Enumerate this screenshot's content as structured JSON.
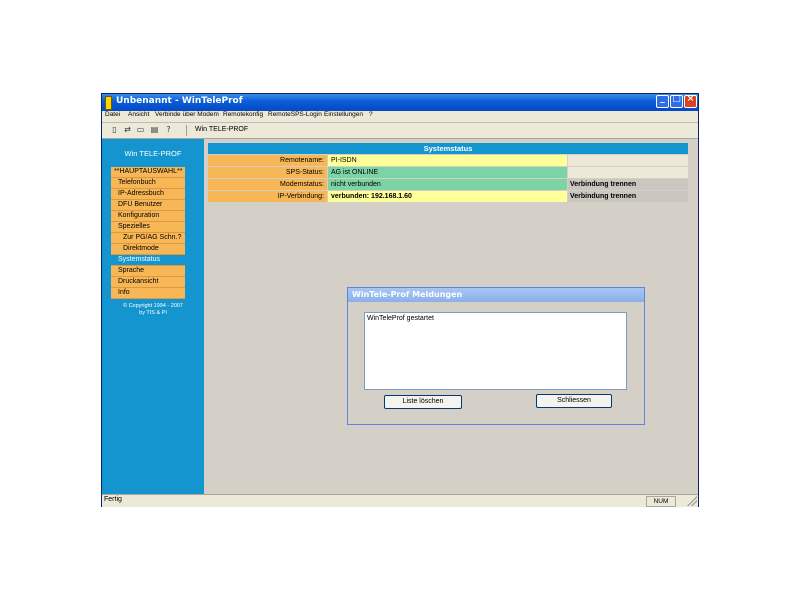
{
  "window": {
    "title": "Unbenannt - WinTeleProf"
  },
  "menu": [
    {
      "label": "Datei"
    },
    {
      "label": "Ansicht"
    },
    {
      "label": "Verbinde über Modem"
    },
    {
      "label": "Remotekonfig"
    },
    {
      "label": "RemoteSPS-Login"
    },
    {
      "label": "Einstellungen"
    },
    {
      "label": "?"
    }
  ],
  "toolbar": {
    "icons": [
      "new-icon",
      "connect-icon",
      "modem-icon",
      "print-icon",
      "help-icon"
    ],
    "title": "Win TELE-PROF"
  },
  "sidebar": {
    "title": "Win TELE-PROF",
    "items": [
      {
        "label": "**HAUPTAUSWAHL**"
      },
      {
        "label": "Telefonbuch"
      },
      {
        "label": "IP-Adressbuch"
      },
      {
        "label": "DFÜ Benutzer"
      },
      {
        "label": "Konfiguration"
      },
      {
        "label": "Spezielles"
      },
      {
        "label": "Zur PG/AG Schn.?"
      },
      {
        "label": "Direktmode"
      },
      {
        "label": "Systemstatus"
      },
      {
        "label": "Sprache"
      },
      {
        "label": "Druckansicht"
      },
      {
        "label": "Info"
      }
    ],
    "copyright_line1": "© Copyright 1994 - 2007",
    "copyright_line2": "by TIS & PI"
  },
  "systemstatus": {
    "title": "Systemstatus",
    "rows": [
      {
        "label": "Remotename:",
        "value": "PI-ISDN",
        "action": ""
      },
      {
        "label": "SPS-Status:",
        "value": "AG ist ONLINE",
        "action": ""
      },
      {
        "label": "Modemstatus:",
        "value": "nicht verbunden",
        "action": "Verbindung trennen"
      },
      {
        "label": "IP-Verbindung:",
        "value": "verbunden: 192.168.1.60",
        "action": "Verbindung trennen"
      }
    ]
  },
  "dialog": {
    "title": "WinTele-Prof Meldungen",
    "messages": [
      "WinTeleProf gestartet"
    ],
    "clear_label": "Liste löschen",
    "close_label": "Schliessen"
  },
  "statusbar": {
    "text": "Fertig",
    "num": "NUM"
  },
  "colors": {
    "accent": "#1495cf",
    "nav_item": "#f7b757",
    "value_yellow": "#ffff99",
    "value_green": "#7cd3a3"
  }
}
